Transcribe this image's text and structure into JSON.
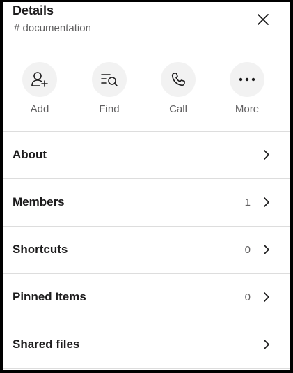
{
  "header": {
    "title": "Details",
    "channel": "# documentation",
    "close_icon": "close-icon"
  },
  "actions": [
    {
      "label": "Add",
      "icon": "add-user-icon"
    },
    {
      "label": "Find",
      "icon": "find-icon"
    },
    {
      "label": "Call",
      "icon": "phone-icon"
    },
    {
      "label": "More",
      "icon": "more-icon"
    }
  ],
  "rows": [
    {
      "label": "About",
      "count": ""
    },
    {
      "label": "Members",
      "count": "1"
    },
    {
      "label": "Shortcuts",
      "count": "0"
    },
    {
      "label": "Pinned Items",
      "count": "0"
    },
    {
      "label": "Shared files",
      "count": ""
    }
  ],
  "colors": {
    "text_primary": "#1d1c1d",
    "text_secondary": "#616061",
    "divider": "#dddddd",
    "action_bg": "#f2f2f2"
  }
}
